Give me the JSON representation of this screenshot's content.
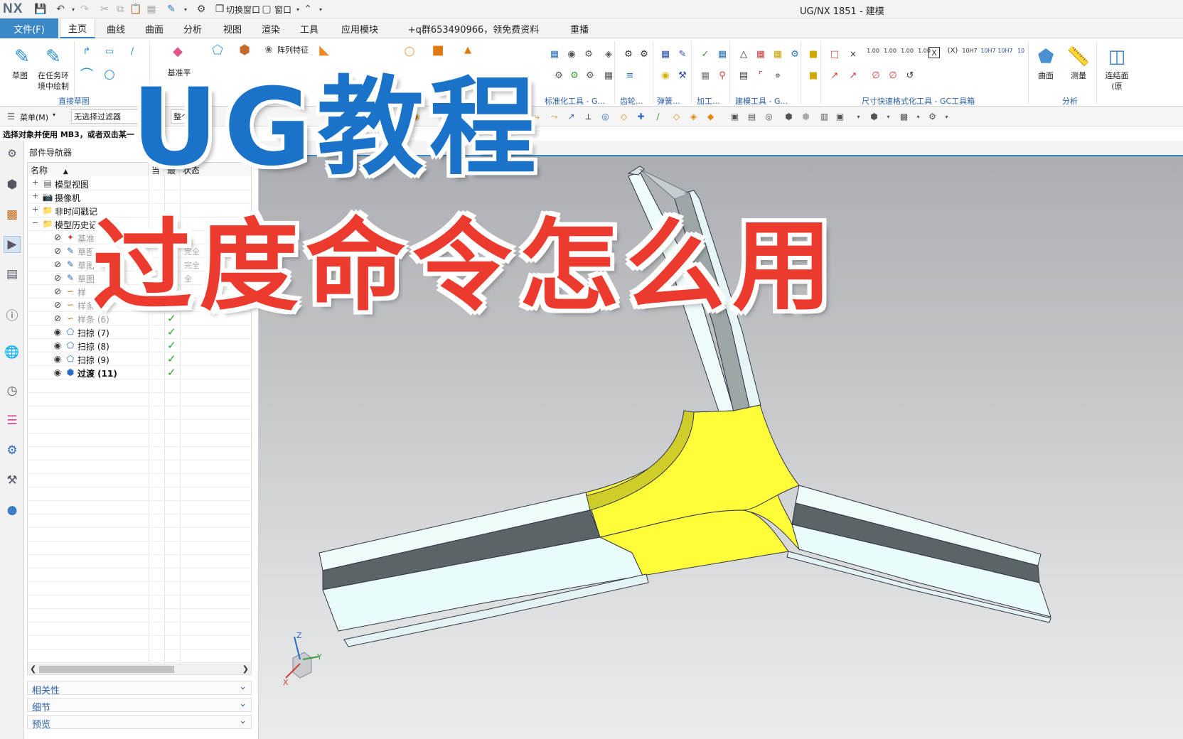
{
  "app": {
    "logo": "NX",
    "window_title": "UG/NX 1851 - 建模",
    "switch_window": "切换窗口",
    "window_menu": "窗口"
  },
  "tabs": [
    "文件(F)",
    "主页",
    "曲线",
    "曲面",
    "分析",
    "视图",
    "渲染",
    "工具",
    "应用模块",
    "+q群653490966，领免费资料",
    "重播"
  ],
  "ribbon": {
    "sketch": "草图",
    "sketch_in_task_line1": "在任务环",
    "sketch_in_task_line2": "境中绘制",
    "direct_sketch_group": "直接草图",
    "datum_plane": "基准平",
    "pattern_feature": "阵列特征",
    "standardize_group": "标准化工具 - G...",
    "gear_group": "齿轮...",
    "spring_group": "弹簧...",
    "machining_group": "加工...",
    "modeling_tools_group": "建模工具 - G...",
    "dim_format_group": "尺寸快速格式化工具 - GC工具箱",
    "surface": "曲面",
    "measure": "测量",
    "analysis_group": "分析",
    "connect_face_line1": "连结面",
    "connect_face_line2": "(原",
    "dim_labels": [
      "1.00",
      "1.00",
      "1.00",
      "1.00",
      "X",
      "(X)",
      "10H7",
      "10H7",
      "10H7",
      "10"
    ]
  },
  "selection_bar": {
    "menu": "菜单(M)",
    "filter": "无选择过滤器",
    "scope": "整个"
  },
  "prompt": "选择对象并使用 MB3，或者双击某一",
  "navigator": {
    "title": "部件导航器",
    "columns": [
      "名称",
      "当",
      "最",
      "状态"
    ],
    "rows": [
      {
        "label": "模型视图",
        "indent": 0,
        "icon": "model-views-icon",
        "style": "normal",
        "check": false,
        "status": ""
      },
      {
        "label": "摄像机",
        "indent": 0,
        "icon": "camera-icon",
        "style": "normal",
        "check": false,
        "status": ""
      },
      {
        "label": "非时间戳记",
        "indent": 0,
        "icon": "folder-icon",
        "style": "normal",
        "check": false,
        "status": ""
      },
      {
        "label": "模型历史记",
        "indent": 0,
        "icon": "folder-icon",
        "style": "normal",
        "check": false,
        "status": ""
      },
      {
        "label": "基准",
        "indent": 1,
        "icon": "datum-icon",
        "style": "dim",
        "check": false,
        "status": ""
      },
      {
        "label": "草图 (",
        "indent": 1,
        "icon": "sketch-icon",
        "style": "dim",
        "check": false,
        "status": "完全"
      },
      {
        "label": "草图",
        "indent": 1,
        "icon": "sketch-icon",
        "style": "dim",
        "check": false,
        "status": "完全"
      },
      {
        "label": "草图",
        "indent": 1,
        "icon": "sketch-icon",
        "style": "dim",
        "check": false,
        "status": "全"
      },
      {
        "label": "样",
        "indent": 1,
        "icon": "spline-icon",
        "style": "dim",
        "check": false,
        "status": ""
      },
      {
        "label": "样条 (5)",
        "indent": 1,
        "icon": "spline-icon",
        "style": "dim",
        "check": true,
        "status": ""
      },
      {
        "label": "样条 (6)",
        "indent": 1,
        "icon": "spline-icon",
        "style": "dim",
        "check": true,
        "status": ""
      },
      {
        "label": "扫掠 (7)",
        "indent": 1,
        "icon": "sweep-icon",
        "style": "normal",
        "check": true,
        "status": ""
      },
      {
        "label": "扫掠 (8)",
        "indent": 1,
        "icon": "sweep-icon",
        "style": "normal",
        "check": true,
        "status": ""
      },
      {
        "label": "扫掠 (9)",
        "indent": 1,
        "icon": "sweep-icon",
        "style": "normal",
        "check": true,
        "status": ""
      },
      {
        "label": "过渡 (11)",
        "indent": 1,
        "icon": "transition-icon",
        "style": "bold",
        "check": true,
        "status": ""
      }
    ],
    "panels": [
      "相关性",
      "细节",
      "预览"
    ]
  },
  "overlay": {
    "line1": "UG教程",
    "line2": "过度命令怎么用"
  },
  "triad": {
    "z": "Z",
    "y": "Y",
    "x": "X"
  },
  "colors": {
    "file_tab": "#3a88c5",
    "title_blue": "#1a72c9",
    "title_red": "#ec3a2e",
    "transition_yellow": "#fdfd3a",
    "sweep_face": "#e9fbfb",
    "sweep_dark": "#5b6466"
  }
}
